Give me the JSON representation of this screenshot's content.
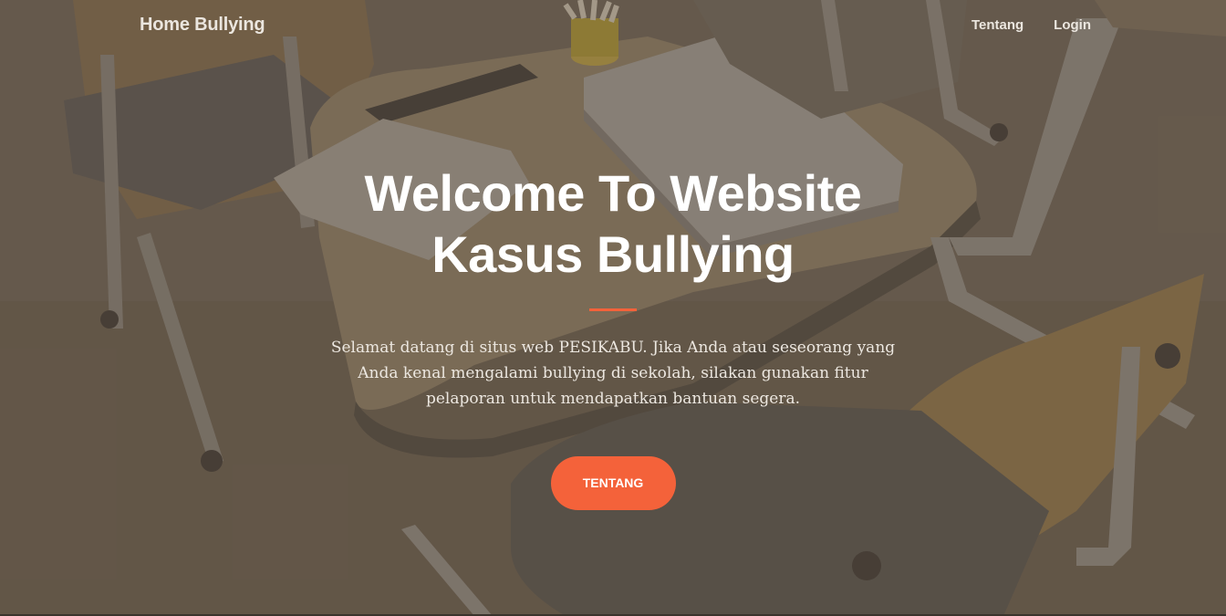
{
  "navbar": {
    "brand": "Home Bullying",
    "links": [
      {
        "label": "Tentang"
      },
      {
        "label": "Login"
      }
    ]
  },
  "hero": {
    "title_line1": "Welcome To Website",
    "title_line2": "Kasus Bullying",
    "description": "Selamat datang di situs web PESIKABU. Jika Anda atau seseorang yang Anda kenal mengalami bullying di sekolah, silakan gunakan fitur pelaporan untuk mendapatkan bantuan segera.",
    "cta_label": "TENTANG",
    "background_image": "classroom-desks-photo"
  },
  "colors": {
    "accent": "#f4623a",
    "overlay": "#5c5042",
    "text_light": "#ffffff"
  }
}
